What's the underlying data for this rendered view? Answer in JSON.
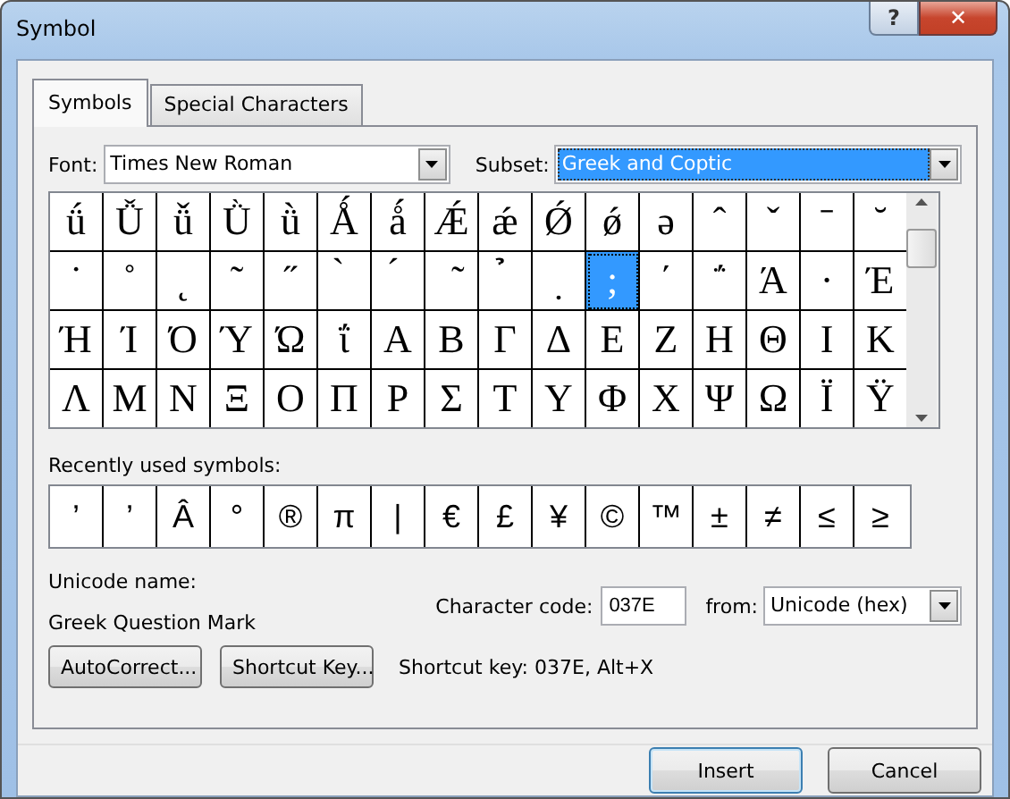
{
  "window": {
    "title": "Symbol",
    "help_button": "?",
    "close_button": "✕"
  },
  "tabs": [
    {
      "label": "Symbols",
      "selected": true
    },
    {
      "label": "Special Characters",
      "selected": false
    }
  ],
  "font": {
    "label": "Font:",
    "value": "Times New Roman"
  },
  "subset": {
    "label": "Subset:",
    "value": "Greek and Coptic"
  },
  "symbol_grid": {
    "rows": [
      [
        {
          "symbol": "ǘ",
          "selected": false
        },
        {
          "symbol": "Ǚ",
          "selected": false
        },
        {
          "symbol": "ǚ",
          "selected": false
        },
        {
          "symbol": "Ǜ",
          "selected": false
        },
        {
          "symbol": "ǜ",
          "selected": false
        },
        {
          "symbol": "Ǻ",
          "selected": false
        },
        {
          "symbol": "ǻ",
          "selected": false
        },
        {
          "symbol": "Ǽ",
          "selected": false
        },
        {
          "symbol": "ǽ",
          "selected": false
        },
        {
          "symbol": "Ǿ",
          "selected": false
        },
        {
          "symbol": "ǿ",
          "selected": false
        },
        {
          "symbol": "ə",
          "selected": false
        },
        {
          "symbol": "ˆ",
          "selected": false
        },
        {
          "symbol": "ˇ",
          "selected": false
        },
        {
          "symbol": "ˉ",
          "selected": false
        },
        {
          "symbol": "˘",
          "selected": false
        }
      ],
      [
        {
          "symbol": "˙",
          "selected": false
        },
        {
          "symbol": "˚",
          "selected": false
        },
        {
          "symbol": "˛",
          "selected": false
        },
        {
          "symbol": "˜",
          "selected": false
        },
        {
          "symbol": "˝",
          "selected": false
        },
        {
          "symbol": "̀",
          "selected": false
        },
        {
          "symbol": "́",
          "selected": false
        },
        {
          "symbol": "̃",
          "selected": false
        },
        {
          "symbol": "̉",
          "selected": false
        },
        {
          "symbol": "̣",
          "selected": false
        },
        {
          "symbol": ";",
          "selected": true
        },
        {
          "symbol": "΄",
          "selected": false
        },
        {
          "symbol": "΅",
          "selected": false
        },
        {
          "symbol": "Ά",
          "selected": false
        },
        {
          "symbol": "·",
          "selected": false
        },
        {
          "symbol": "Έ",
          "selected": false
        }
      ],
      [
        {
          "symbol": "Ή",
          "selected": false
        },
        {
          "symbol": "Ί",
          "selected": false
        },
        {
          "symbol": "Ό",
          "selected": false
        },
        {
          "symbol": "Ύ",
          "selected": false
        },
        {
          "symbol": "Ώ",
          "selected": false
        },
        {
          "symbol": "ΐ",
          "selected": false
        },
        {
          "symbol": "Α",
          "selected": false
        },
        {
          "symbol": "Β",
          "selected": false
        },
        {
          "symbol": "Γ",
          "selected": false
        },
        {
          "symbol": "Δ",
          "selected": false
        },
        {
          "symbol": "Ε",
          "selected": false
        },
        {
          "symbol": "Ζ",
          "selected": false
        },
        {
          "symbol": "Η",
          "selected": false
        },
        {
          "symbol": "Θ",
          "selected": false
        },
        {
          "symbol": "Ι",
          "selected": false
        },
        {
          "symbol": "Κ",
          "selected": false
        }
      ],
      [
        {
          "symbol": "Λ",
          "selected": false
        },
        {
          "symbol": "Μ",
          "selected": false
        },
        {
          "symbol": "Ν",
          "selected": false
        },
        {
          "symbol": "Ξ",
          "selected": false
        },
        {
          "symbol": "Ο",
          "selected": false
        },
        {
          "symbol": "Π",
          "selected": false
        },
        {
          "symbol": "Ρ",
          "selected": false
        },
        {
          "symbol": "Σ",
          "selected": false
        },
        {
          "symbol": "Τ",
          "selected": false
        },
        {
          "symbol": "Υ",
          "selected": false
        },
        {
          "symbol": "Φ",
          "selected": false
        },
        {
          "symbol": "Χ",
          "selected": false
        },
        {
          "symbol": "Ψ",
          "selected": false
        },
        {
          "symbol": "Ω",
          "selected": false
        },
        {
          "symbol": "Ϊ",
          "selected": false
        },
        {
          "symbol": "Ϋ",
          "selected": false
        }
      ]
    ]
  },
  "recent": {
    "label": "Recently used symbols:",
    "symbols": [
      "’",
      "’",
      "Â",
      "°",
      "®",
      "π",
      "|",
      "€",
      "£",
      "¥",
      "©",
      "™",
      "±",
      "≠",
      "≤",
      "≥"
    ]
  },
  "unicode_name": {
    "label": "Unicode name:",
    "value": "Greek Question Mark"
  },
  "character_code": {
    "label": "Character code:",
    "value": "037E"
  },
  "from": {
    "label": "from:",
    "value": "Unicode (hex)"
  },
  "buttons": [
    {
      "label": "AutoCorrect..."
    },
    {
      "label": "Shortcut Key..."
    }
  ],
  "shortcut_text": "Shortcut key: 037E, Alt+X",
  "footer_buttons": [
    {
      "label": "Insert",
      "default": true
    },
    {
      "label": "Cancel",
      "default": false
    }
  ]
}
